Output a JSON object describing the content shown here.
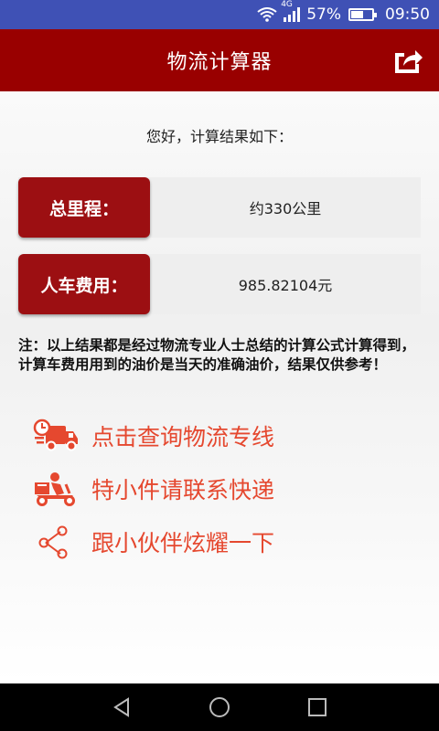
{
  "status_bar": {
    "network": "4G",
    "battery_percent": "57%",
    "time": "09:50"
  },
  "app_bar": {
    "title": "物流计算器",
    "share_icon": "share-icon"
  },
  "greeting": "您好，计算结果如下：",
  "results": [
    {
      "label": "总里程：",
      "value": "约330公里"
    },
    {
      "label": "人车费用：",
      "value": "985.82104元"
    }
  ],
  "note": "注：以上结果都是经过物流专业人士总结的计算公式计算得到，计算车费用用到的油价是当天的准确油价，结果仅供参考！",
  "links": [
    {
      "label": "点击查询物流专线",
      "icon": "delivery-truck-icon"
    },
    {
      "label": "特小件请联系快递",
      "icon": "courier-scooter-icon"
    },
    {
      "label": "跟小伙伴炫耀一下",
      "icon": "share-nodes-icon"
    }
  ],
  "colors": {
    "status_bar": "#3f51b5",
    "app_bar": "#990000",
    "label_bg": "#9c0f12",
    "link_text": "#e5482f"
  }
}
